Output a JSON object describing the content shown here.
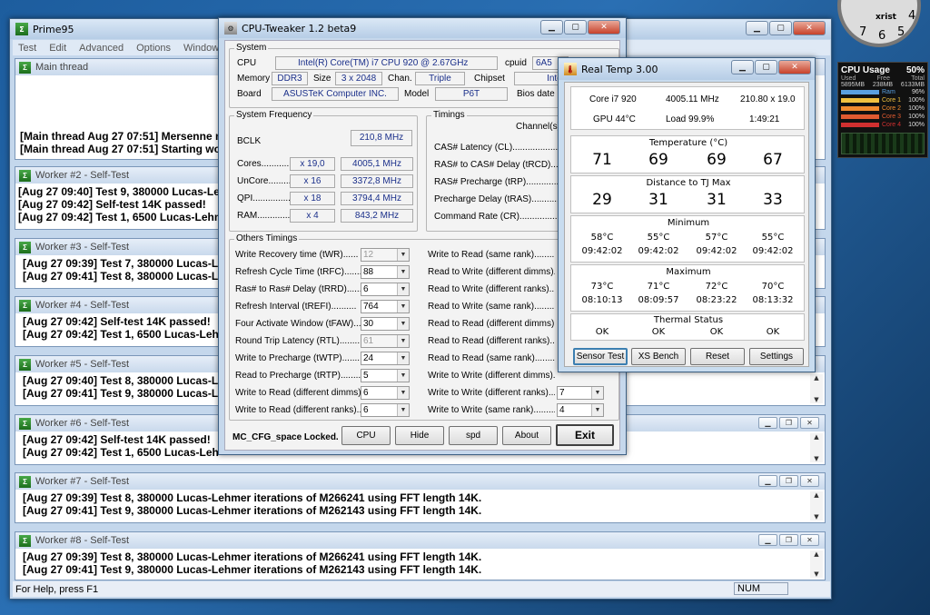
{
  "prime95": {
    "title": "Prime95",
    "menu": [
      "Test",
      "Edit",
      "Advanced",
      "Options",
      "Window"
    ],
    "status": "For Help, press F1",
    "num": "NUM",
    "main": {
      "title": "Main thread",
      "lines": [
        "[Main thread Aug 27 07:51] Mersenne n",
        "[Main thread Aug 27 07:51] Starting wor"
      ]
    },
    "workers": [
      {
        "title": "Worker #2 - Self-Test",
        "lines": [
          "[Aug 27 09:40] Test 9, 380000 Lucas-Le",
          "[Aug 27 09:42] Self-test 14K passed!",
          "[Aug 27 09:42] Test 1, 6500 Lucas-Lehm"
        ]
      },
      {
        "title": "Worker #3 - Self-Test",
        "lines": [
          "[Aug 27 09:39] Test 7, 380000 Lucas-L",
          "[Aug 27 09:41] Test 8, 380000 Lucas-L"
        ]
      },
      {
        "title": "Worker #4 - Self-Test",
        "lines": [
          "[Aug 27 09:42] Self-test 14K passed!",
          "[Aug 27 09:42] Test 1, 6500 Lucas-Leh"
        ]
      },
      {
        "title": "Worker #5 - Self-Test",
        "lines": [
          "[Aug 27 09:40] Test 8, 380000 Lucas-L",
          "[Aug 27 09:41] Test 9, 380000 Lucas-L"
        ]
      },
      {
        "title": "Worker #6 - Self-Test",
        "lines": [
          "[Aug 27 09:42] Self-test 14K passed!",
          "[Aug 27 09:42] Test 1, 6500 Lucas-Leh"
        ]
      },
      {
        "title": "Worker #7 - Self-Test",
        "lines": [
          "[Aug 27 09:39] Test 8, 380000 Lucas-Lehmer iterations of M266241 using FFT length 14K.",
          "[Aug 27 09:41] Test 9, 380000 Lucas-Lehmer iterations of M262143 using FFT length 14K."
        ]
      },
      {
        "title": "Worker #8 - Self-Test",
        "lines": [
          "[Aug 27 09:39] Test 8, 380000 Lucas-Lehmer iterations of M266241 using FFT length 14K.",
          "[Aug 27 09:41] Test 9, 380000 Lucas-Lehmer iterations of M262143 using FFT length 14K."
        ]
      }
    ]
  },
  "tweaker": {
    "title": "CPU-Tweaker 1.2 beta9",
    "system_label": "System",
    "cpu_label": "CPU",
    "cpu": "Intel(R) Core(TM) i7 CPU        920  @ 2.67GHz",
    "cpuid_label": "cpuid",
    "cpuid": "6A5",
    "memory_label": "Memory",
    "memory": "DDR3",
    "size_label": "Size",
    "size": "3 x 2048",
    "chan_label": "Chan.",
    "chan": "Triple",
    "chipset_label": "Chipset",
    "chipset": "Intel",
    "board_label": "Board",
    "board": "ASUSTeK Computer INC.",
    "model_label": "Model",
    "model": "P6T",
    "bios_label": "Bios date",
    "freq_label": "System Frequency",
    "bclk_label": "BCLK",
    "bclk": "210,8 MHz",
    "freq_rows": [
      {
        "label": "Cores...............",
        "mult": "x 19,0",
        "val": "4005,1 MHz"
      },
      {
        "label": "UnCore.............",
        "mult": "x 16",
        "val": "3372,8 MHz"
      },
      {
        "label": "QPI...................",
        "mult": "x 18",
        "val": "3794,4 MHz"
      },
      {
        "label": "RAM..................",
        "mult": "x 4",
        "val": "843,2 MHz"
      }
    ],
    "timings_label": "Timings",
    "channel_label": "Channel(s)",
    "timings": [
      "CAS# Latency (CL)...................",
      "RAS# to CAS# Delay (tRCD)..........",
      "RAS# Precharge (tRP)..................",
      "Precharge Delay (tRAS)................",
      "Command Rate (CR)...................."
    ],
    "others_label": "Others Timings",
    "others_left": [
      {
        "label": "Write Recovery time (tWR)......",
        "val": "12",
        "dis": true
      },
      {
        "label": "Refresh Cycle Time (tRFC).......",
        "val": "88"
      },
      {
        "label": "Ras# to Ras# Delay (tRRD)......",
        "val": "6"
      },
      {
        "label": "Refresh Interval (tREFI)..........",
        "val": "764"
      },
      {
        "label": "Four Activate Window (tFAW)....",
        "val": "30"
      },
      {
        "label": "Round Trip Latency (RTL).........",
        "val": "61",
        "dis": true
      },
      {
        "label": "Write to Precharge (tWTP).......",
        "val": "24"
      },
      {
        "label": "Read to Precharge (tRTP)........",
        "val": "5"
      },
      {
        "label": "Write to Read (different dimms)....",
        "val": "6"
      },
      {
        "label": "Write to Read (different ranks)....",
        "val": "6"
      }
    ],
    "others_right": [
      {
        "label": "Write to Read (same rank)..............."
      },
      {
        "label": "Read to Write (different dimms)........."
      },
      {
        "label": "Read to Write (different ranks)........."
      },
      {
        "label": "Read to Write (same rank)..............."
      },
      {
        "label": "Read to Read (different dimms)........."
      },
      {
        "label": "Read to Read (different ranks).........."
      },
      {
        "label": "Read to Read (same rank)................"
      },
      {
        "label": "Write to Write (different dimms)........"
      },
      {
        "label": "Write to Write (different ranks)........",
        "val": "7"
      },
      {
        "label": "Write to Write (same rank)...............",
        "val": "4"
      }
    ],
    "locked": "MC_CFG_space Locked.",
    "buttons": {
      "cpu": "CPU",
      "hide": "Hide",
      "spd": "spd",
      "about": "About",
      "exit": "Exit"
    }
  },
  "realtemp": {
    "title": "Real Temp 3.00",
    "cpu": "Core i7 920",
    "mhz": "4005.11 MHz",
    "ratio": "210.80 x 19.0",
    "gpu": "GPU  44°C",
    "load": "Load  99.9%",
    "time": "1:49:21",
    "temp_label": "Temperature (°C)",
    "temps": [
      "71",
      "69",
      "69",
      "67"
    ],
    "dist_label": "Distance to TJ Max",
    "dists": [
      "29",
      "31",
      "31",
      "33"
    ],
    "min_label": "Minimum",
    "min": [
      {
        "t": "58°C",
        "ts": "09:42:02"
      },
      {
        "t": "55°C",
        "ts": "09:42:02"
      },
      {
        "t": "57°C",
        "ts": "09:42:02"
      },
      {
        "t": "55°C",
        "ts": "09:42:02"
      }
    ],
    "max_label": "Maximum",
    "max": [
      {
        "t": "73°C",
        "ts": "08:10:13"
      },
      {
        "t": "71°C",
        "ts": "08:09:57"
      },
      {
        "t": "72°C",
        "ts": "08:23:22"
      },
      {
        "t": "70°C",
        "ts": "08:13:32"
      }
    ],
    "thermal_label": "Thermal Status",
    "status": [
      "OK",
      "OK",
      "OK",
      "OK"
    ],
    "buttons": {
      "sensor": "Sensor Test",
      "xs": "XS Bench",
      "reset": "Reset",
      "settings": "Settings"
    }
  },
  "gadget": {
    "title": "CPU Usage",
    "pct": "50%",
    "used_label": "Used",
    "free_label": "Free",
    "total_label": "Total",
    "used": "5895MB",
    "free": "238MB",
    "total": "6133MB",
    "rows": [
      {
        "label": "Ram",
        "val": "96%",
        "color": "#5aa0e0"
      },
      {
        "label": "Core 1",
        "val": "100%",
        "color": "#f0c040"
      },
      {
        "label": "Core 2",
        "val": "100%",
        "color": "#f08a30"
      },
      {
        "label": "Core 3",
        "val": "100%",
        "color": "#e05a30"
      },
      {
        "label": "Core 4",
        "val": "100%",
        "color": "#d03030"
      }
    ]
  },
  "clock": {
    "brand": "xrist",
    "n4": "4",
    "n5": "5",
    "n6": "6",
    "n7": "7"
  }
}
